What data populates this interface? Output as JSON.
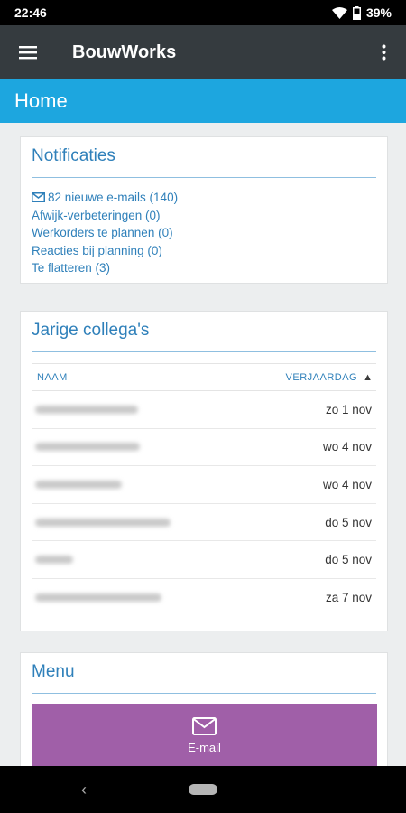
{
  "status_bar": {
    "time": "22:46",
    "battery": "39%"
  },
  "app_bar": {
    "title": "BouwWorks"
  },
  "page": {
    "title": "Home"
  },
  "notifications": {
    "title": "Notificaties",
    "items": [
      {
        "icon": "envelope-icon",
        "text": "82 nieuwe e-mails (140)"
      },
      {
        "text": "Afwijk-verbeteringen (0)"
      },
      {
        "text": "Werkorders te plannen (0)"
      },
      {
        "text": "Reacties bij planning (0)"
      },
      {
        "text": "Te flatteren (3)"
      }
    ]
  },
  "birthdays": {
    "title": "Jarige collega's",
    "columns": {
      "name": "NAAM",
      "date": "VERJAARDAG"
    },
    "sort_indicator": "▲",
    "rows": [
      {
        "date": "zo 1 nov"
      },
      {
        "date": "wo 4 nov"
      },
      {
        "date": "wo 4 nov"
      },
      {
        "date": "do 5 nov"
      },
      {
        "date": "do 5 nov"
      },
      {
        "date": "za 7 nov"
      }
    ]
  },
  "menu": {
    "title": "Menu",
    "tiles": [
      {
        "icon": "envelope-icon",
        "label": "E-mail",
        "color": "#a05fa8"
      }
    ]
  },
  "colors": {
    "app_bar": "#353b3f",
    "page_header": "#1da6df",
    "link": "#2f80ba"
  }
}
